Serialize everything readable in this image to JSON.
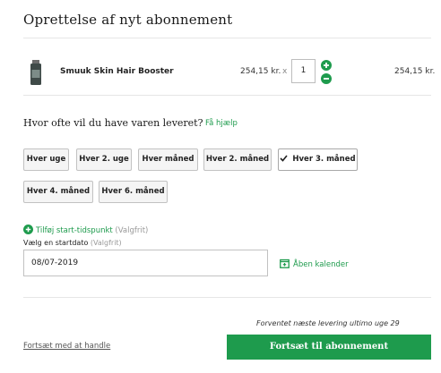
{
  "page": {
    "title": "Oprettelse af nyt abonnement"
  },
  "product": {
    "thumb_icon": "supplement-bottle-icon",
    "name": "Smuuk Skin Hair Booster",
    "unit_price": "254,15 kr.",
    "times": "x",
    "quantity": "1",
    "line_total": "254,15 kr."
  },
  "frequency": {
    "question": "Hvor ofte vil du have varen leveret?",
    "help_link": "Få hjælp",
    "options": [
      "Hver uge",
      "Hver 2. uge",
      "Hver måned",
      "Hver 2. måned",
      "Hver 3. måned",
      "Hver 4. måned",
      "Hver 6. måned"
    ],
    "selected": "Hver 3. måned"
  },
  "schedule": {
    "add_time_label": "Tilføj start-tidspunkt",
    "add_time_optional": "(Valgfrit)",
    "date_label": "Vælg en startdato",
    "date_optional": "(Valgfrit)",
    "date_value": "08/07-2019",
    "open_calendar": "Åben kalender"
  },
  "footer": {
    "next_delivery": "Forventet næste levering ultimo uge 29",
    "continue_shopping": "Fortsæt med at handle",
    "continue_subscription": "Fortsæt til abonnement"
  },
  "colors": {
    "accent": "#1e9b4d",
    "button_bg": "#f5f5f5",
    "border": "#c2c2c2"
  }
}
